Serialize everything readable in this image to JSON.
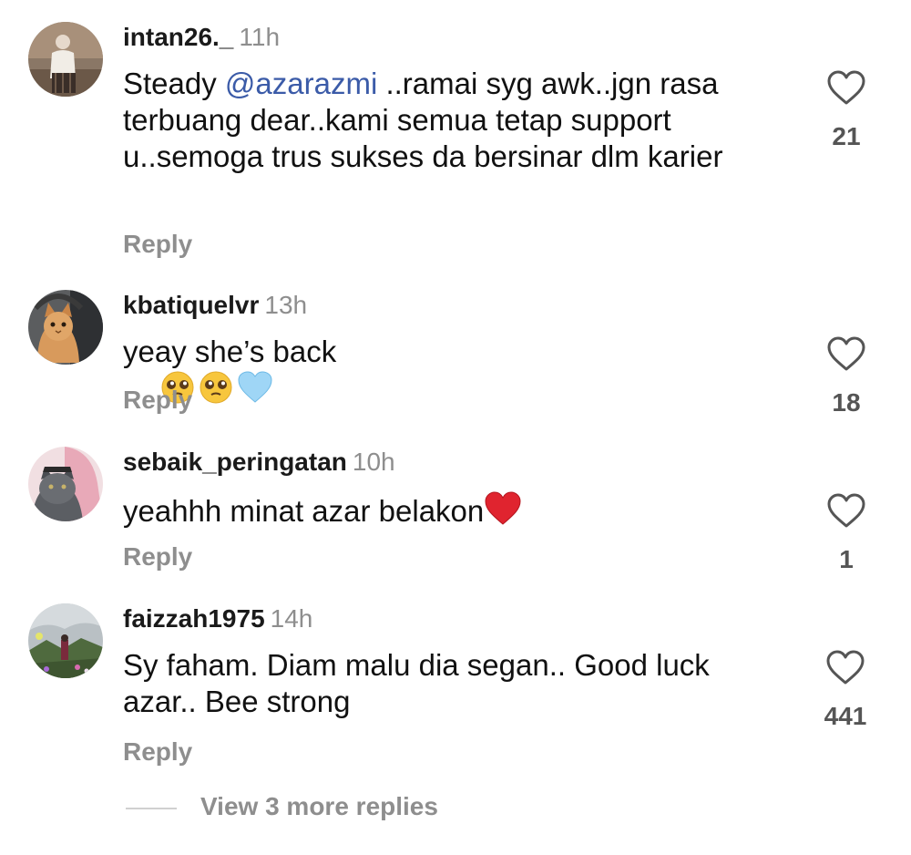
{
  "comments": [
    {
      "username": "intan26._",
      "time": "11h",
      "text_before": "Steady ",
      "mention": "@azarazmi",
      "text_after": " ..ramai syg awk..jgn rasa terbuang dear..kami semua tetap support u..semoga trus sukses da bersinar dlm karier",
      "reply_label": "Reply",
      "likes": "21"
    },
    {
      "username": "kbatiquelvr",
      "time": "13h",
      "text": "yeay she’s back",
      "emojis": [
        "pleading-face",
        "pleading-face",
        "light-blue-heart"
      ],
      "reply_label": "Reply",
      "likes": "18"
    },
    {
      "username": "sebaik_peringatan",
      "time": "10h",
      "text": "yeahhh minat azar belakon",
      "emojis": [
        "red-heart"
      ],
      "reply_label": "Reply",
      "likes": "1"
    },
    {
      "username": "faizzah1975",
      "time": "14h",
      "text": "Sy faham. Diam malu dia segan.. Good luck azar.. Bee strong",
      "reply_label": "Reply",
      "likes": "441"
    }
  ],
  "view_more_label": "View 3 more replies",
  "colors": {
    "username": "#1a1a1a",
    "meta_gray": "#8e8e8e",
    "mention_blue": "#3b5ba8",
    "count_gray": "#555555"
  }
}
